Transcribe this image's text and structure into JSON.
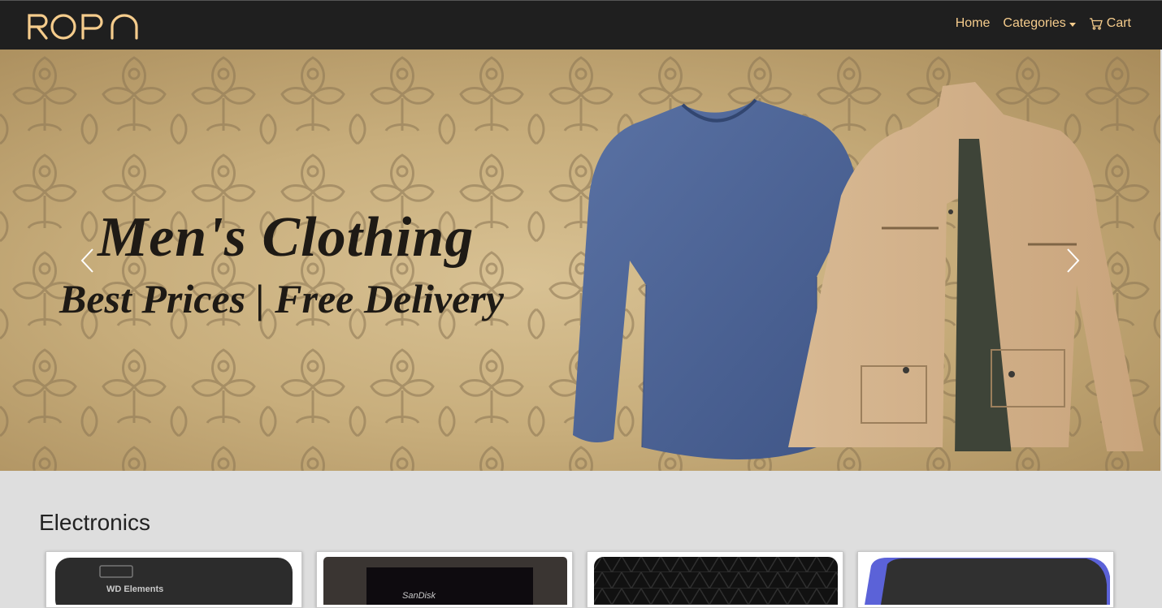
{
  "brand": {
    "logo_text": "ROPN"
  },
  "nav": {
    "home": "Home",
    "categories": "Categories",
    "cart": "Cart"
  },
  "hero": {
    "title": "Men's Clothing",
    "subtitle": "Best Prices | Free Delivery"
  },
  "section": {
    "title": "Electronics",
    "products": [
      {
        "brand_text": "WD Elements"
      },
      {
        "brand_text": "SanDisk"
      },
      {
        "brand_text": ""
      },
      {
        "brand_text": ""
      }
    ]
  },
  "colors": {
    "navbar_bg": "#1f1f1f",
    "accent": "#f5cc8c",
    "page_bg": "#dedede"
  },
  "icons": [
    "cart-icon",
    "chevron-left-icon",
    "chevron-right-icon",
    "caret-down-icon"
  ]
}
